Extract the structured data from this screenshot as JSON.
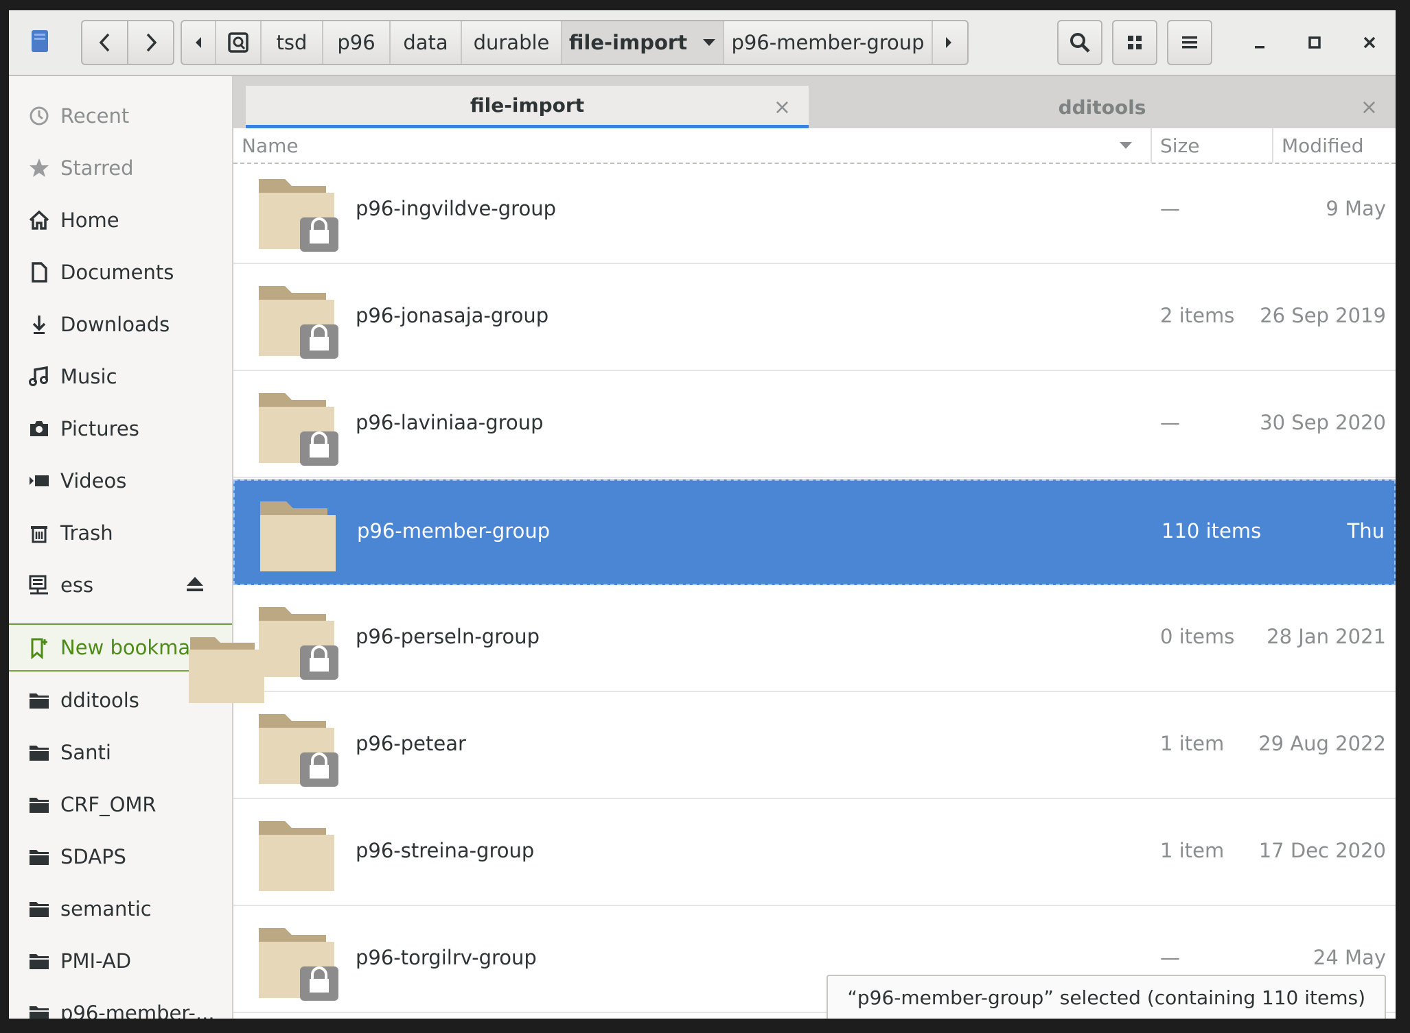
{
  "header": {
    "app_icon": "file-manager-icon",
    "back_icon": "chevron-left-icon",
    "forward_icon": "chevron-right-icon",
    "crumbs": [
      {
        "label": "tsd"
      },
      {
        "label": "p96"
      },
      {
        "label": "data"
      },
      {
        "label": "durable"
      },
      {
        "label": "file-import"
      },
      {
        "label": "p96-member-group"
      }
    ],
    "current_crumb": "file-import",
    "search_icon": "search-icon",
    "grid_view_icon": "grid-view-icon",
    "menu_icon": "hamburger-menu-icon",
    "minimize_icon": "minimize-icon",
    "maximize_icon": "maximize-icon",
    "close_icon": "close-icon"
  },
  "sidebar": {
    "places": [
      {
        "label": "Recent",
        "icon": "clock-icon"
      },
      {
        "label": "Starred",
        "icon": "star-icon"
      },
      {
        "label": "Home",
        "icon": "home-icon"
      },
      {
        "label": "Documents",
        "icon": "document-icon"
      },
      {
        "label": "Downloads",
        "icon": "download-icon"
      },
      {
        "label": "Music",
        "icon": "music-icon"
      },
      {
        "label": "Pictures",
        "icon": "camera-icon"
      },
      {
        "label": "Videos",
        "icon": "video-icon"
      },
      {
        "label": "Trash",
        "icon": "trash-icon"
      },
      {
        "label": "ess",
        "icon": "network-drive-icon"
      }
    ],
    "new_bookmark": "New bookmark",
    "bookmarks": [
      {
        "label": "dditools"
      },
      {
        "label": "Santi"
      },
      {
        "label": "CRF_OMR"
      },
      {
        "label": "SDAPS"
      },
      {
        "label": "semantic"
      },
      {
        "label": "PMI-AD"
      },
      {
        "label": "p96-member-..."
      }
    ]
  },
  "tabs": [
    {
      "label": "file-import",
      "active": true
    },
    {
      "label": "dditools",
      "active": false
    }
  ],
  "columns": {
    "name": "Name",
    "size": "Size",
    "modified": "Modified"
  },
  "files": [
    {
      "name": "p96-ingvildve-group",
      "size": "—",
      "modified": "9 May",
      "locked": true,
      "selected": false
    },
    {
      "name": "p96-jonasaja-group",
      "size": "2 items",
      "modified": "26 Sep 2019",
      "locked": true,
      "selected": false
    },
    {
      "name": "p96-laviniaa-group",
      "size": "—",
      "modified": "30 Sep 2020",
      "locked": true,
      "selected": false
    },
    {
      "name": "p96-member-group",
      "size": "110 items",
      "modified": "Thu",
      "locked": false,
      "selected": true
    },
    {
      "name": "p96-perseln-group",
      "size": "0 items",
      "modified": "28 Jan 2021",
      "locked": true,
      "selected": false
    },
    {
      "name": "p96-petear",
      "size": "1 item",
      "modified": "29 Aug 2022",
      "locked": true,
      "selected": false
    },
    {
      "name": "p96-streina-group",
      "size": "1 item",
      "modified": "17 Dec 2020",
      "locked": false,
      "selected": false
    },
    {
      "name": "p96-torgilrv-group",
      "size": "—",
      "modified": "24 May",
      "locked": true,
      "selected": false
    }
  ],
  "status_text": "“p96-member-group” selected  (containing 110 items)",
  "colors": {
    "selection": "#4a86d4",
    "accent": "#3584e4",
    "folder": "#e6d7b8",
    "bookmark_green": "#4e8a18"
  }
}
